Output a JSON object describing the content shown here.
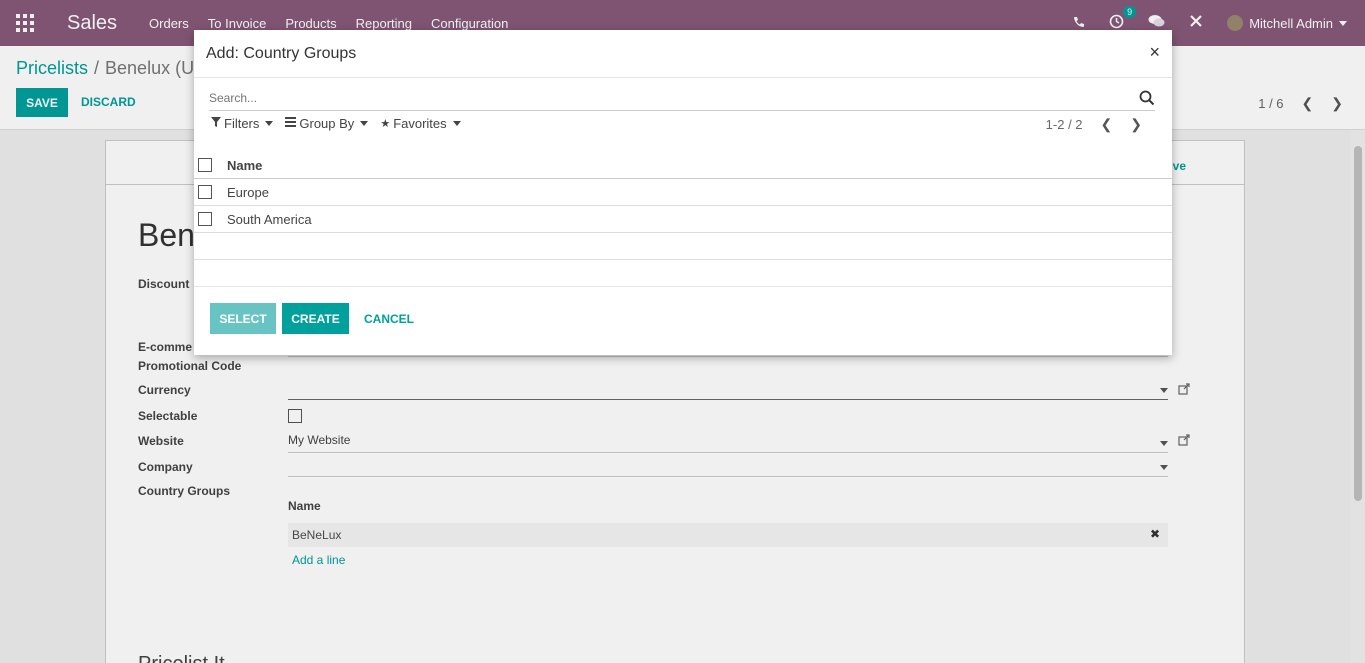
{
  "navbar": {
    "app_name": "Sales",
    "menu": [
      "Orders",
      "To Invoice",
      "Products",
      "Reporting",
      "Configuration"
    ],
    "activity_badge": "9",
    "user_name": "Mitchell Admin"
  },
  "control_panel": {
    "breadcrumb_root": "Pricelists",
    "breadcrumb_separator": "/",
    "breadcrumb_current": "Benelux (U",
    "save_label": "SAVE",
    "discard_label": "DISCARD",
    "pager": "1 / 6"
  },
  "form": {
    "archive_peek": "ve",
    "title_peek": "Bene",
    "labels": {
      "discount": "Discount",
      "ecommerce": "E-comme",
      "promo": "Promotional Code",
      "currency": "Currency",
      "selectable": "Selectable",
      "website": "Website",
      "company": "Company",
      "country_groups": "Country Groups"
    },
    "website_value": "My Website",
    "country_groups_header": "Name",
    "country_groups_rows": [
      "BeNeLux"
    ],
    "add_line": "Add a line",
    "pricelist_items_peek": "Pricelist It"
  },
  "modal": {
    "title": "Add: Country Groups",
    "close": "×",
    "search_placeholder": "Search...",
    "filters_label": "Filters",
    "group_by_label": "Group By",
    "favorites_label": "Favorites",
    "pager": "1-2 / 2",
    "column_name": "Name",
    "rows": [
      "Europe",
      "South America"
    ],
    "select_label": "SELECT",
    "create_label": "CREATE",
    "cancel_label": "CANCEL"
  },
  "colors": {
    "brand": "#875a7b",
    "accent": "#00a09d"
  }
}
